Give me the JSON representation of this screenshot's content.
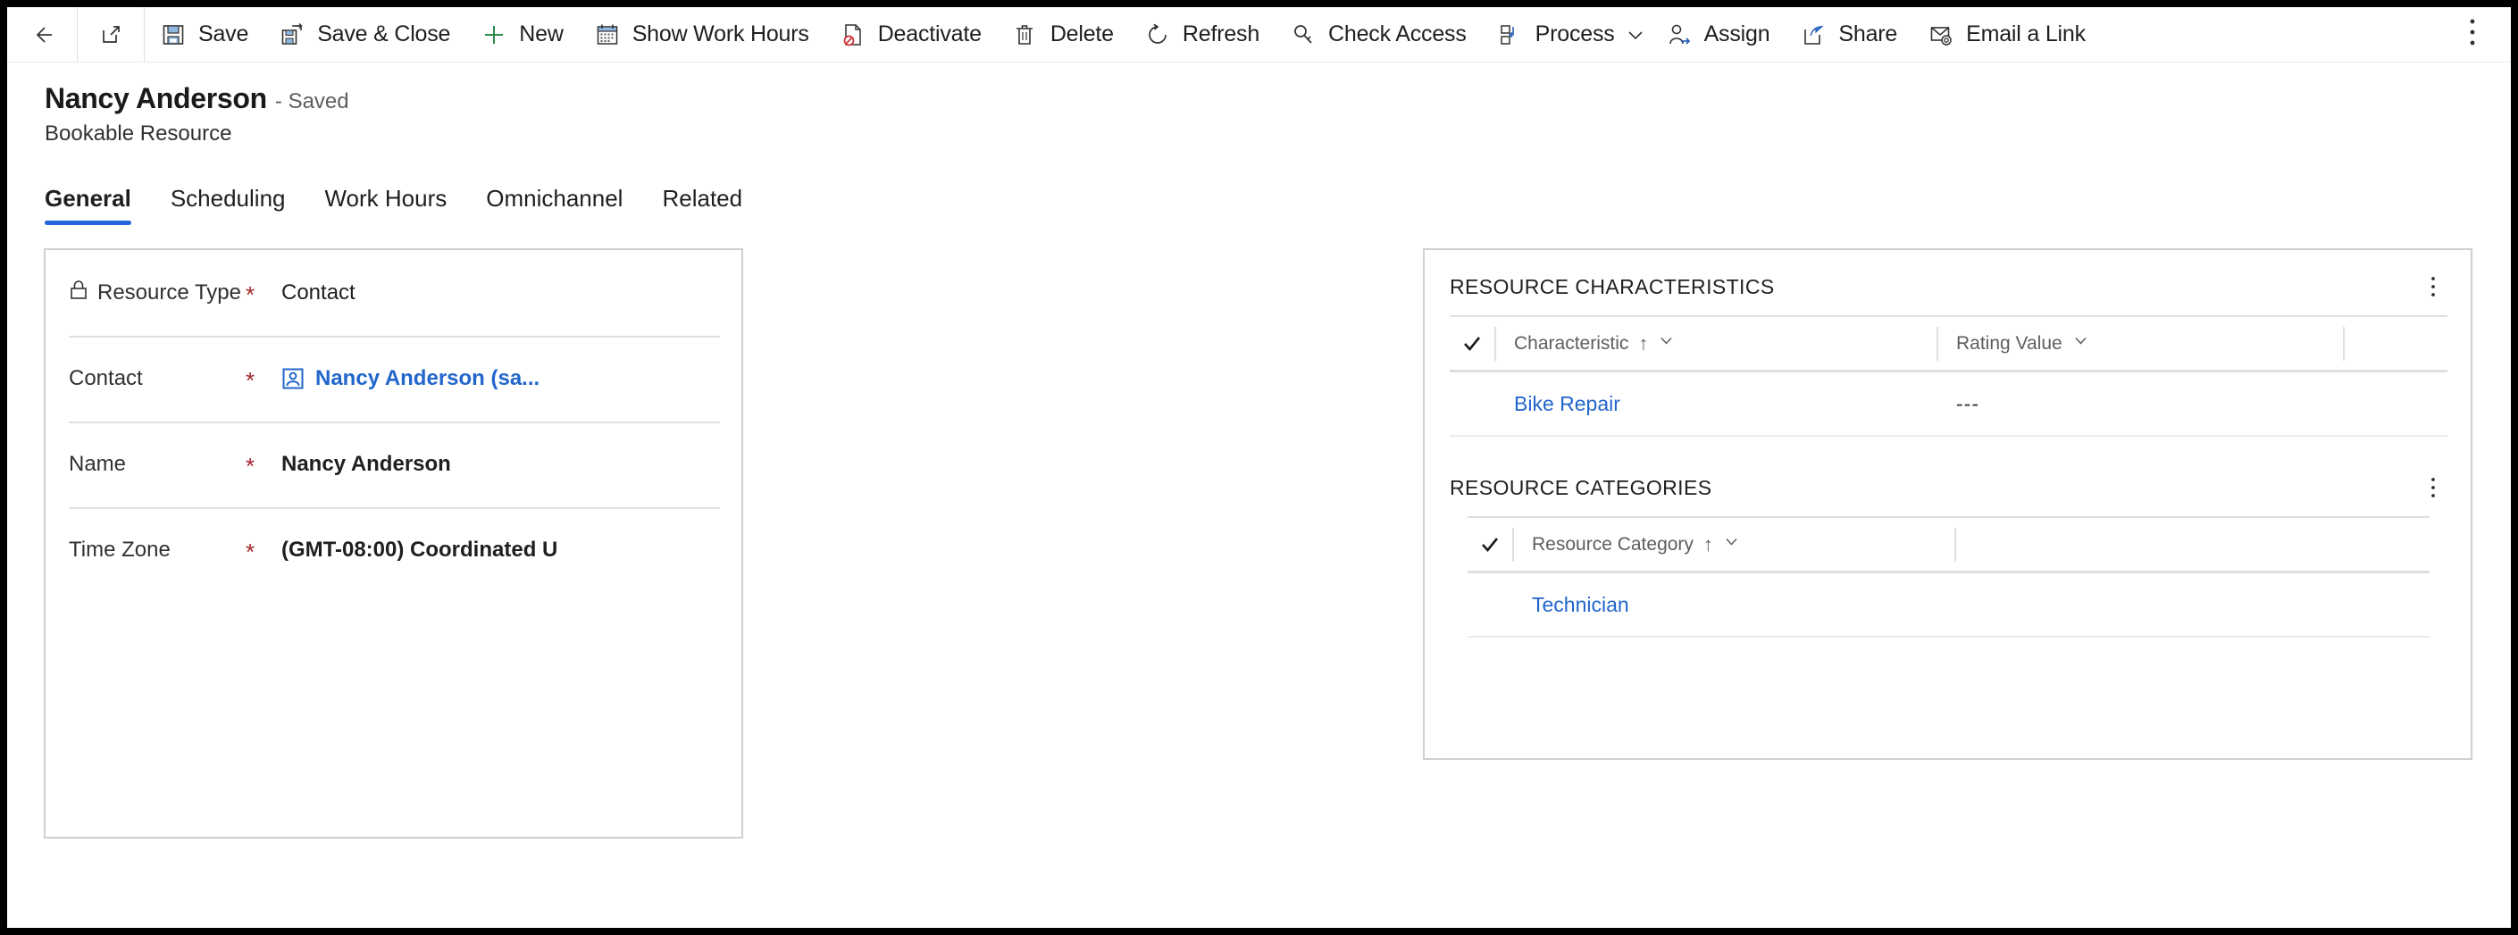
{
  "commandbar": {
    "back_tooltip": "Back",
    "popout_tooltip": "Open in new window",
    "items": [
      {
        "label": "Save",
        "icon": "save-icon"
      },
      {
        "label": "Save & Close",
        "icon": "save-and-close-icon"
      },
      {
        "label": "New",
        "icon": "plus-icon"
      },
      {
        "label": "Show Work Hours",
        "icon": "calendar-icon"
      },
      {
        "label": "Deactivate",
        "icon": "deactivate-icon"
      },
      {
        "label": "Delete",
        "icon": "trash-icon"
      },
      {
        "label": "Refresh",
        "icon": "refresh-icon"
      },
      {
        "label": "Check Access",
        "icon": "key-icon"
      },
      {
        "label": "Process",
        "icon": "process-icon"
      },
      {
        "label": "Assign",
        "icon": "assign-user-icon"
      },
      {
        "label": "Share",
        "icon": "share-icon"
      },
      {
        "label": "Email a Link",
        "icon": "email-link-icon"
      }
    ],
    "overflow_label": "More commands"
  },
  "header": {
    "record_title": "Nancy Anderson",
    "record_status": "- Saved",
    "entity_name": "Bookable Resource"
  },
  "tabs": [
    {
      "label": "General",
      "active": true
    },
    {
      "label": "Scheduling",
      "active": false
    },
    {
      "label": "Work Hours",
      "active": false
    },
    {
      "label": "Omnichannel",
      "active": false
    },
    {
      "label": "Related",
      "active": false
    }
  ],
  "form": {
    "fields": [
      {
        "label": "Resource Type",
        "required": "*",
        "value": "Contact",
        "locked": true,
        "style": "plain"
      },
      {
        "label": "Contact",
        "required": "*",
        "value": "Nancy Anderson (sa...",
        "locked": false,
        "style": "link"
      },
      {
        "label": "Name",
        "required": "*",
        "value": "Nancy Anderson",
        "locked": false,
        "style": "bold"
      },
      {
        "label": "Time Zone",
        "required": "*",
        "value": "(GMT-08:00) Coordinated U",
        "locked": false,
        "style": "bold"
      }
    ]
  },
  "side_panel": {
    "characteristics": {
      "title": "RESOURCE CHARACTERISTICS",
      "more_label": "More commands",
      "columns": [
        {
          "label": "Characteristic",
          "sorted": "↑"
        },
        {
          "label": "Rating Value",
          "sorted": ""
        }
      ],
      "rows": [
        {
          "characteristic": "Bike Repair",
          "rating_value": "---"
        }
      ]
    },
    "categories": {
      "title": "RESOURCE CATEGORIES",
      "more_label": "More commands",
      "columns": [
        {
          "label": "Resource Category",
          "sorted": "↑"
        }
      ],
      "rows": [
        {
          "resource_category": "Technician"
        }
      ]
    }
  },
  "colors": {
    "accent": "#2266dd",
    "link": "#2266cc",
    "required": "#a4262c",
    "border": "#d2d0ce"
  }
}
